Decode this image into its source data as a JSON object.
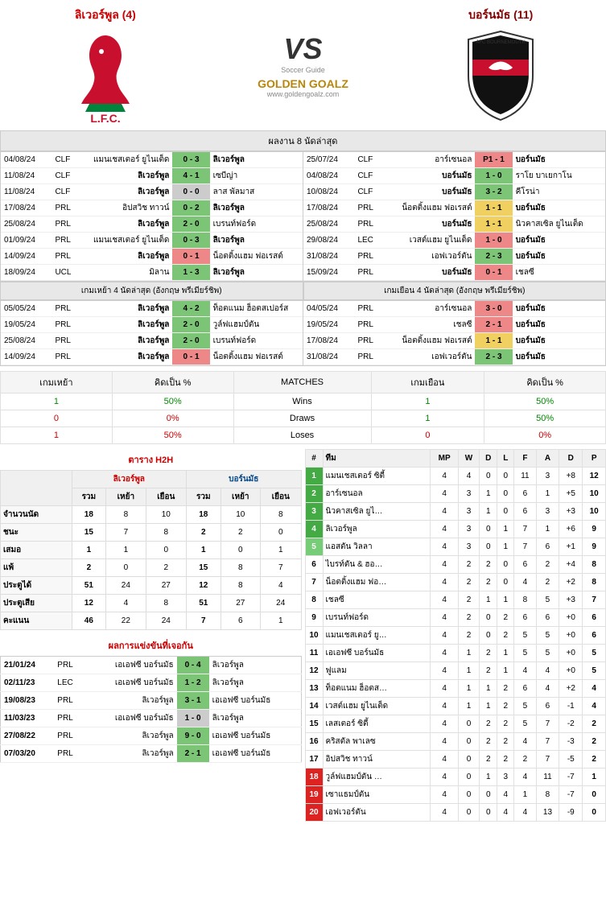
{
  "home": {
    "name": "ลิเวอร์พูล (4)",
    "short": "ลิเวอร์พูล",
    "badge_text": "L.F.C."
  },
  "away": {
    "name": "บอร์นมัธ (11)",
    "short": "บอร์นมัธ",
    "badge_text": "AFC BOURNEMOUTH"
  },
  "vs": "VS",
  "site": {
    "name": "GOLDEN GOALZ",
    "sub": "Soccer Guide",
    "url": "www.goldengoalz.com"
  },
  "section_last8": "ผลงาน 8 นัดล่าสุด",
  "last8_home": [
    {
      "date": "04/08/24",
      "comp": "CLF",
      "h": "แมนเชสเตอร์ ยูไนเต็ด",
      "s": "0 - 3",
      "a": "ลิเวอร์พูล",
      "cls": "sc-green",
      "bold": "a"
    },
    {
      "date": "11/08/24",
      "comp": "CLF",
      "h": "ลิเวอร์พูล",
      "s": "4 - 1",
      "a": "เซบีญ่า",
      "cls": "sc-green",
      "bold": "h"
    },
    {
      "date": "11/08/24",
      "comp": "CLF",
      "h": "ลิเวอร์พูล",
      "s": "0 - 0",
      "a": "ลาส พัลมาส",
      "cls": "sc-gray",
      "bold": "h"
    },
    {
      "date": "17/08/24",
      "comp": "PRL",
      "h": "อิปสวิช ทาวน์",
      "s": "0 - 2",
      "a": "ลิเวอร์พูล",
      "cls": "sc-green",
      "bold": "a"
    },
    {
      "date": "25/08/24",
      "comp": "PRL",
      "h": "ลิเวอร์พูล",
      "s": "2 - 0",
      "a": "เบรนท์ฟอร์ด",
      "cls": "sc-green",
      "bold": "h"
    },
    {
      "date": "01/09/24",
      "comp": "PRL",
      "h": "แมนเชสเตอร์ ยูไนเต็ด",
      "s": "0 - 3",
      "a": "ลิเวอร์พูล",
      "cls": "sc-green",
      "bold": "a"
    },
    {
      "date": "14/09/24",
      "comp": "PRL",
      "h": "ลิเวอร์พูล",
      "s": "0 - 1",
      "a": "น็อตติ้งแฮม ฟอเรสต์",
      "cls": "sc-red",
      "bold": "h"
    },
    {
      "date": "18/09/24",
      "comp": "UCL",
      "h": "มิลาน",
      "s": "1 - 3",
      "a": "ลิเวอร์พูล",
      "cls": "sc-green",
      "bold": "a"
    }
  ],
  "last8_away": [
    {
      "date": "25/07/24",
      "comp": "CLF",
      "h": "อาร์เซนอล",
      "s": "P1 - 1",
      "a": "บอร์นมัธ",
      "cls": "sc-red",
      "bold": "a"
    },
    {
      "date": "04/08/24",
      "comp": "CLF",
      "h": "บอร์นมัธ",
      "s": "1 - 0",
      "a": "ราโย บาเยกาโน",
      "cls": "sc-green",
      "bold": "h"
    },
    {
      "date": "10/08/24",
      "comp": "CLF",
      "h": "บอร์นมัธ",
      "s": "3 - 2",
      "a": "คีโรน่า",
      "cls": "sc-green",
      "bold": "h"
    },
    {
      "date": "17/08/24",
      "comp": "PRL",
      "h": "น็อตติ้งแฮม ฟอเรสต์",
      "s": "1 - 1",
      "a": "บอร์นมัธ",
      "cls": "sc-yellow",
      "bold": "a"
    },
    {
      "date": "25/08/24",
      "comp": "PRL",
      "h": "บอร์นมัธ",
      "s": "1 - 1",
      "a": "นิวคาสเซิล ยูไนเต็ด",
      "cls": "sc-yellow",
      "bold": "h"
    },
    {
      "date": "29/08/24",
      "comp": "LEC",
      "h": "เวสต์แฮม ยูไนเต็ด",
      "s": "1 - 0",
      "a": "บอร์นมัธ",
      "cls": "sc-red",
      "bold": "a"
    },
    {
      "date": "31/08/24",
      "comp": "PRL",
      "h": "เอฟเวอร์ตัน",
      "s": "2 - 3",
      "a": "บอร์นมัธ",
      "cls": "sc-green",
      "bold": "a"
    },
    {
      "date": "15/09/24",
      "comp": "PRL",
      "h": "บอร์นมัธ",
      "s": "0 - 1",
      "a": "เชลซี",
      "cls": "sc-red",
      "bold": "h"
    }
  ],
  "sub_home4": "เกมเหย้า 4 นัดล่าสุด (อังกฤษ พรีเมียร์ชิพ)",
  "sub_away4": "เกมเยือน 4 นัดล่าสุด (อังกฤษ พรีเมียร์ชิพ)",
  "home4": [
    {
      "date": "05/05/24",
      "comp": "PRL",
      "h": "ลิเวอร์พูล",
      "s": "4 - 2",
      "a": "ท็อตแนม ฮ็อตสเปอร์ส",
      "cls": "sc-green",
      "bold": "h"
    },
    {
      "date": "19/05/24",
      "comp": "PRL",
      "h": "ลิเวอร์พูล",
      "s": "2 - 0",
      "a": "วูล์ฟแฮมป์ตัน",
      "cls": "sc-green",
      "bold": "h"
    },
    {
      "date": "25/08/24",
      "comp": "PRL",
      "h": "ลิเวอร์พูล",
      "s": "2 - 0",
      "a": "เบรนท์ฟอร์ด",
      "cls": "sc-green",
      "bold": "h"
    },
    {
      "date": "14/09/24",
      "comp": "PRL",
      "h": "ลิเวอร์พูล",
      "s": "0 - 1",
      "a": "น็อตติ้งแฮม ฟอเรสต์",
      "cls": "sc-red",
      "bold": "h"
    }
  ],
  "away4": [
    {
      "date": "04/05/24",
      "comp": "PRL",
      "h": "อาร์เซนอล",
      "s": "3 - 0",
      "a": "บอร์นมัธ",
      "cls": "sc-red",
      "bold": "a"
    },
    {
      "date": "19/05/24",
      "comp": "PRL",
      "h": "เชลซี",
      "s": "2 - 1",
      "a": "บอร์นมัธ",
      "cls": "sc-red",
      "bold": "a"
    },
    {
      "date": "17/08/24",
      "comp": "PRL",
      "h": "น็อตติ้งแฮม ฟอเรสต์",
      "s": "1 - 1",
      "a": "บอร์นมัธ",
      "cls": "sc-yellow",
      "bold": "a"
    },
    {
      "date": "31/08/24",
      "comp": "PRL",
      "h": "เอฟเวอร์ตัน",
      "s": "2 - 3",
      "a": "บอร์นมัธ",
      "cls": "sc-green",
      "bold": "a"
    }
  ],
  "summary": {
    "headers": [
      "เกมเหย้า",
      "คิดเป็น %",
      "MATCHES",
      "เกมเยือน",
      "คิดเป็น %"
    ],
    "rows": [
      {
        "h": "1",
        "hp": "50%",
        "m": "Wins",
        "a": "1",
        "ap": "50%",
        "hc": "num-green",
        "ac": "num-green"
      },
      {
        "h": "0",
        "hp": "0%",
        "m": "Draws",
        "a": "1",
        "ap": "50%",
        "hc": "num-red",
        "ac": "num-green"
      },
      {
        "h": "1",
        "hp": "50%",
        "m": "Loses",
        "a": "0",
        "ap": "0%",
        "hc": "num-red",
        "ac": "num-red"
      }
    ]
  },
  "h2h": {
    "title": "ตาราง H2H",
    "teams": [
      "ลิเวอร์พูล",
      "บอร์นมัธ"
    ],
    "cols": [
      "รวม",
      "เหย้า",
      "เยือน",
      "รวม",
      "เหย้า",
      "เยือน"
    ],
    "rows": [
      {
        "label": "จำนวนนัด",
        "v": [
          "18",
          "8",
          "10",
          "18",
          "10",
          "8"
        ]
      },
      {
        "label": "ชนะ",
        "v": [
          "15",
          "7",
          "8",
          "2",
          "2",
          "0"
        ]
      },
      {
        "label": "เสมอ",
        "v": [
          "1",
          "1",
          "0",
          "1",
          "0",
          "1"
        ]
      },
      {
        "label": "แพ้",
        "v": [
          "2",
          "0",
          "2",
          "15",
          "8",
          "7"
        ]
      },
      {
        "label": "ประตูได้",
        "v": [
          "51",
          "24",
          "27",
          "12",
          "8",
          "4"
        ]
      },
      {
        "label": "ประตูเสีย",
        "v": [
          "12",
          "4",
          "8",
          "51",
          "27",
          "24"
        ]
      },
      {
        "label": "คะแนน",
        "v": [
          "46",
          "22",
          "24",
          "7",
          "6",
          "1"
        ]
      }
    ]
  },
  "encounters": {
    "title": "ผลการแข่งขันที่เจอกัน",
    "rows": [
      {
        "date": "21/01/24",
        "comp": "PRL",
        "h": "เอเอฟซี บอร์นมัธ",
        "s": "0 - 4",
        "a": "ลิเวอร์พูล",
        "cls": "sc-green"
      },
      {
        "date": "02/11/23",
        "comp": "LEC",
        "h": "เอเอฟซี บอร์นมัธ",
        "s": "1 - 2",
        "a": "ลิเวอร์พูล",
        "cls": "sc-green"
      },
      {
        "date": "19/08/23",
        "comp": "PRL",
        "h": "ลิเวอร์พูล",
        "s": "3 - 1",
        "a": "เอเอฟซี บอร์นมัธ",
        "cls": "sc-green"
      },
      {
        "date": "11/03/23",
        "comp": "PRL",
        "h": "เอเอฟซี บอร์นมัธ",
        "s": "1 - 0",
        "a": "ลิเวอร์พูล",
        "cls": "sc-gray"
      },
      {
        "date": "27/08/22",
        "comp": "PRL",
        "h": "ลิเวอร์พูล",
        "s": "9 - 0",
        "a": "เอเอฟซี บอร์นมัธ",
        "cls": "sc-green"
      },
      {
        "date": "07/03/20",
        "comp": "PRL",
        "h": "ลิเวอร์พูล",
        "s": "2 - 1",
        "a": "เอเอฟซี บอร์นมัธ",
        "cls": "sc-green"
      }
    ]
  },
  "standings": {
    "headers": [
      "#",
      "ทีม",
      "MP",
      "W",
      "D",
      "L",
      "F",
      "A",
      "D",
      "P"
    ],
    "rows": [
      {
        "r": 1,
        "rc": "rank-green",
        "t": "แมนเชสเตอร์ ซิตี้",
        "v": [
          4,
          4,
          0,
          0,
          11,
          3,
          "+8",
          12
        ]
      },
      {
        "r": 2,
        "rc": "rank-green",
        "t": "อาร์เซนอล",
        "v": [
          4,
          3,
          1,
          0,
          6,
          1,
          "+5",
          10
        ]
      },
      {
        "r": 3,
        "rc": "rank-green",
        "t": "นิวคาสเซิล ยูไ…",
        "v": [
          4,
          3,
          1,
          0,
          6,
          3,
          "+3",
          10
        ]
      },
      {
        "r": 4,
        "rc": "rank-green",
        "t": "ลิเวอร์พูล",
        "v": [
          4,
          3,
          0,
          1,
          7,
          1,
          "+6",
          9
        ]
      },
      {
        "r": 5,
        "rc": "rank-lgreen",
        "t": "แอสตัน วิลลา",
        "v": [
          4,
          3,
          0,
          1,
          7,
          6,
          "+1",
          9
        ]
      },
      {
        "r": 6,
        "rc": "",
        "t": "ไบรท์ตัน & ฮอ…",
        "v": [
          4,
          2,
          2,
          0,
          6,
          2,
          "+4",
          8
        ]
      },
      {
        "r": 7,
        "rc": "",
        "t": "น็อตติ้งแฮม ฟอ…",
        "v": [
          4,
          2,
          2,
          0,
          4,
          2,
          "+2",
          8
        ]
      },
      {
        "r": 8,
        "rc": "",
        "t": "เชลซี",
        "v": [
          4,
          2,
          1,
          1,
          8,
          5,
          "+3",
          7
        ]
      },
      {
        "r": 9,
        "rc": "",
        "t": "เบรนท์ฟอร์ด",
        "v": [
          4,
          2,
          0,
          2,
          6,
          6,
          "+0",
          6
        ]
      },
      {
        "r": 10,
        "rc": "",
        "t": "แมนเชสเตอร์ ยู…",
        "v": [
          4,
          2,
          0,
          2,
          5,
          5,
          "+0",
          6
        ]
      },
      {
        "r": 11,
        "rc": "",
        "t": "เอเอฟซี บอร์นมัธ",
        "v": [
          4,
          1,
          2,
          1,
          5,
          5,
          "+0",
          5
        ]
      },
      {
        "r": 12,
        "rc": "",
        "t": "ฟูแลม",
        "v": [
          4,
          1,
          2,
          1,
          4,
          4,
          "+0",
          5
        ]
      },
      {
        "r": 13,
        "rc": "",
        "t": "ท็อตแนม ฮ็อตส…",
        "v": [
          4,
          1,
          1,
          2,
          6,
          4,
          "+2",
          4
        ]
      },
      {
        "r": 14,
        "rc": "",
        "t": "เวสต์แฮม ยูไนเต็ด",
        "v": [
          4,
          1,
          1,
          2,
          5,
          6,
          "-1",
          4
        ]
      },
      {
        "r": 15,
        "rc": "",
        "t": "เลสเตอร์ ซิตี้",
        "v": [
          4,
          0,
          2,
          2,
          5,
          7,
          "-2",
          2
        ]
      },
      {
        "r": 16,
        "rc": "",
        "t": "คริสตัล พาเลซ",
        "v": [
          4,
          0,
          2,
          2,
          4,
          7,
          "-3",
          2
        ]
      },
      {
        "r": 17,
        "rc": "",
        "t": "อิปสวิช ทาวน์",
        "v": [
          4,
          0,
          2,
          2,
          2,
          7,
          "-5",
          2
        ]
      },
      {
        "r": 18,
        "rc": "rank-red",
        "t": "วูล์ฟแฮมป์ตัน …",
        "v": [
          4,
          0,
          1,
          3,
          4,
          11,
          "-7",
          1
        ]
      },
      {
        "r": 19,
        "rc": "rank-red",
        "t": "เซาแธมป์ตัน",
        "v": [
          4,
          0,
          0,
          4,
          1,
          8,
          "-7",
          0
        ]
      },
      {
        "r": 20,
        "rc": "rank-red",
        "t": "เอฟเวอร์ตัน",
        "v": [
          4,
          0,
          0,
          4,
          4,
          13,
          "-9",
          0
        ]
      }
    ]
  }
}
